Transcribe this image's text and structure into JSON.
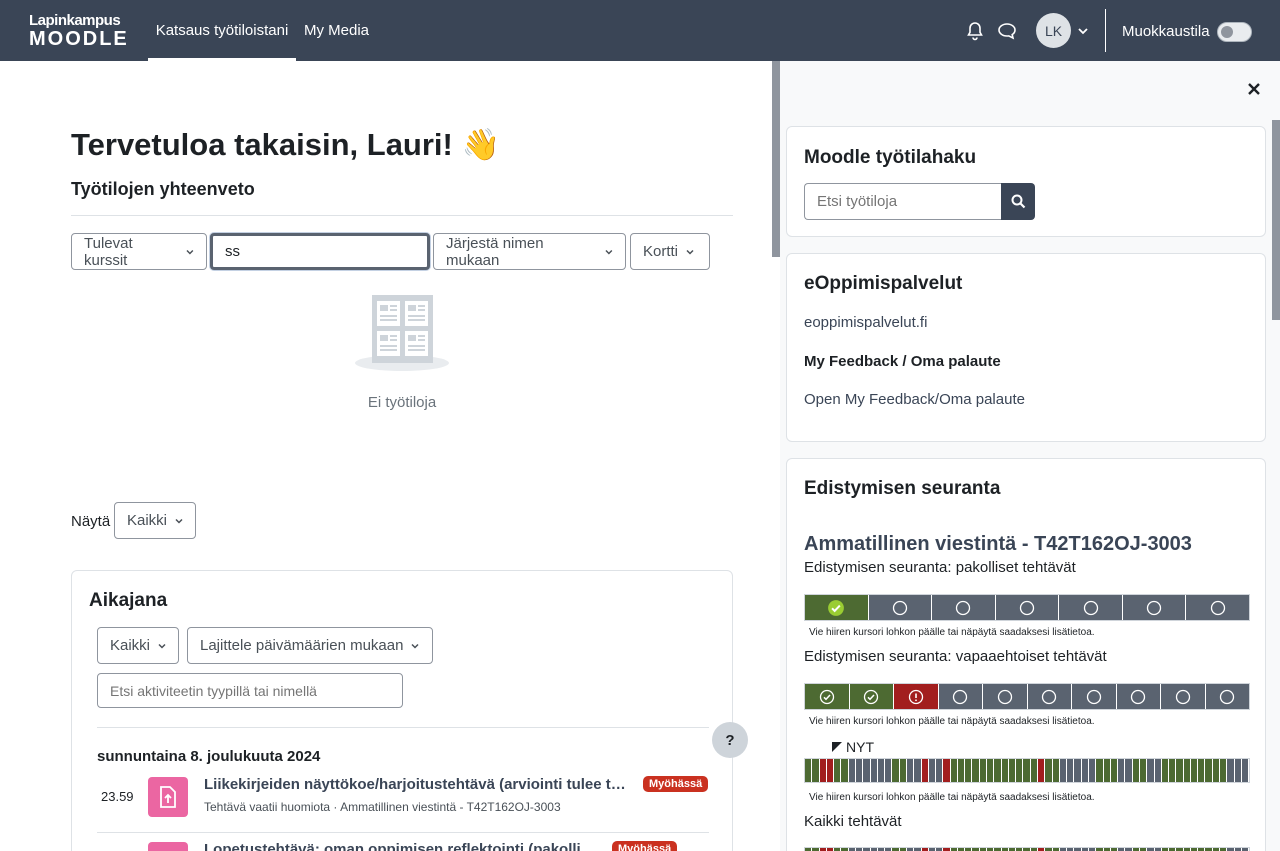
{
  "navbar": {
    "logo_line1": "Lapinkampus",
    "logo_line2": "MOODLE",
    "links": [
      "Katsaus työtiloistani",
      "My Media"
    ],
    "avatar_initials": "LK",
    "edit_mode_label": "Muokkaustila",
    "edit_mode_on": false
  },
  "main": {
    "welcome": "Tervetuloa takaisin, Lauri! 👋",
    "overview_title": "Työtilojen yhteenveto",
    "filters": {
      "grouping": "Tulevat kurssit",
      "search_value": "ss",
      "sort": "Järjestä nimen mukaan",
      "view": "Kortti"
    },
    "empty_text": "Ei työtiloja",
    "show_label": "Näytä",
    "show_value": "Kaikki"
  },
  "timeline": {
    "title": "Aikajana",
    "filter": "Kaikki",
    "sort": "Lajittele päivämäärien mukaan",
    "search_placeholder": "Etsi aktiviteetin tyypillä tai nimellä",
    "date_heading": "sunnuntaina 8. joulukuuta 2024",
    "items": [
      {
        "time": "23.59",
        "name": "Liikekirjeiden näyttökoe/harjoitustehtävä (arviointi tulee tä…",
        "meta": "Tehtävä vaatii huomiota · Ammatillinen viestintä - T42T162OJ-3003",
        "badge": "Myöhässä"
      },
      {
        "time": "",
        "name": "Lopetustehtävä: oman oppimisen reflektointi (pakollinen)",
        "meta": "",
        "badge": "Myöhässä"
      }
    ],
    "help_label": "?"
  },
  "drawer": {
    "workspace_search": {
      "title": "Moodle työtilahaku",
      "placeholder": "Etsi työtiloja"
    },
    "elearning": {
      "title": "eOppimispalvelut",
      "link": "eoppimispalvelut.fi",
      "feedback_title": "My Feedback / Oma palaute",
      "feedback_link": "Open My Feedback/Oma palaute"
    },
    "progress": {
      "title": "Edistymisen seuranta",
      "course": "Ammatillinen viestintä - T42T162OJ-3003",
      "mandatory_label": "Edistymisen seuranta: pakolliset tehtävät",
      "mandatory_cells": [
        "done",
        "todo",
        "todo",
        "todo",
        "todo",
        "todo",
        "todo"
      ],
      "optional_label": "Edistymisen seuranta: vapaaehtoiset tehtävät",
      "optional_cells": [
        "done",
        "done",
        "late",
        "todo",
        "todo",
        "todo",
        "todo",
        "todo",
        "todo",
        "todo"
      ],
      "hint": "Vie hiiren kursori lohkon päälle tai näpäytä saadaksesi lisätietoa.",
      "now_label": "NYT",
      "all_label": "Kaikki tehtävät",
      "all_cells": [
        "g",
        "g",
        "r",
        "r",
        "g",
        "g",
        "x",
        "x",
        "x",
        "x",
        "x",
        "x",
        "g",
        "g",
        "x",
        "x",
        "r",
        "x",
        "x",
        "r",
        "g",
        "g",
        "g",
        "g",
        "g",
        "g",
        "g",
        "g",
        "g",
        "g",
        "g",
        "g",
        "r",
        "g",
        "g",
        "x",
        "x",
        "x",
        "x",
        "x",
        "g",
        "g",
        "g",
        "x",
        "x",
        "g",
        "g",
        "x",
        "x",
        "g",
        "g",
        "g",
        "g",
        "g",
        "g",
        "g",
        "g",
        "g",
        "x",
        "x",
        "x"
      ],
      "colors": {
        "done": "#4d6a32",
        "todo": "#5a6370",
        "late": "#a21e1e"
      }
    }
  }
}
